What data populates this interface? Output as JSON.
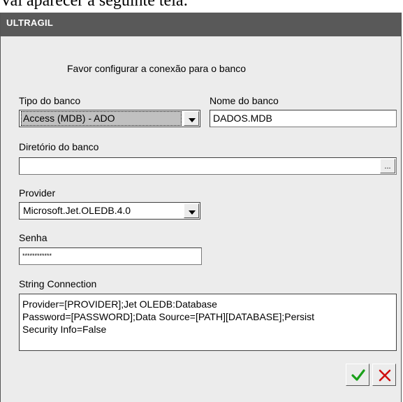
{
  "caption": "Vai aparecer a seguinte tela:",
  "window": {
    "title": "ULTRAGIL"
  },
  "form": {
    "heading": "Favor configurar a conexão para o banco",
    "db_type": {
      "label": "Tipo do banco",
      "value": "Access (MDB) - ADO"
    },
    "db_name": {
      "label": "Nome do banco",
      "value": "DADOS.MDB"
    },
    "db_dir": {
      "label": "Diretório do banco",
      "value": "",
      "browse_label": "..."
    },
    "provider": {
      "label": "Provider",
      "value": "Microsoft.Jet.OLEDB.4.0"
    },
    "password": {
      "label": "Senha",
      "value": "************"
    },
    "conn_string": {
      "label": "String Connection",
      "value": "Provider=[PROVIDER];Jet OLEDB:Database\nPassword=[PASSWORD];Data Source=[PATH][DATABASE];Persist\nSecurity Info=False"
    }
  },
  "buttons": {
    "ok_icon": "check-icon",
    "cancel_icon": "close-icon",
    "ok_color": "#1aa01a",
    "cancel_color": "#d01010"
  }
}
